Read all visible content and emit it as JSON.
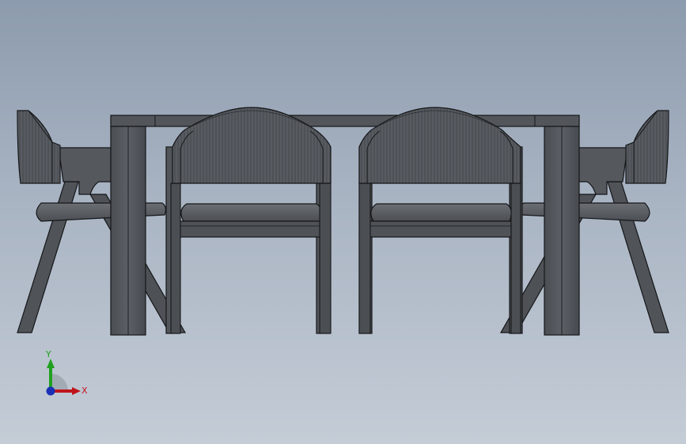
{
  "app": {
    "view": "front-view",
    "model": "dining-table-with-chairs"
  },
  "triad": {
    "x_label": "X",
    "y_label": "Y",
    "x_color": "#c0141c",
    "y_color": "#1fa01f",
    "z_color": "#1a2fb5"
  },
  "colors": {
    "background_top": "#8c9bad",
    "background_bottom": "#c4ccd6",
    "wood": "#55595e",
    "wood_dark": "#3d4145",
    "wood_light": "#6c7177",
    "edge": "#151618",
    "upholstery": "#5d6065"
  }
}
